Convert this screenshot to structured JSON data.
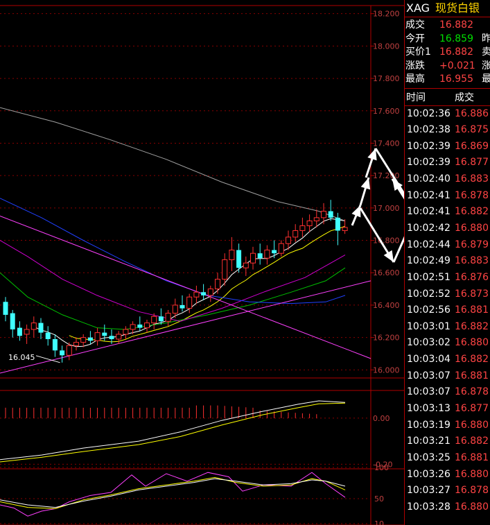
{
  "panel": {
    "symbol": "XAG",
    "name": "现货白银",
    "quotes": [
      {
        "label": "成交",
        "value": "16.882",
        "color": "#ff4444",
        "right": ""
      },
      {
        "label": "今开",
        "value": "16.859",
        "color": "#00e000",
        "right": "昨"
      },
      {
        "label": "买价1",
        "value": "16.882",
        "color": "#ff4444",
        "right": "卖"
      },
      {
        "label": "涨跌",
        "value": "+0.021",
        "color": "#ff4444",
        "right": "涨"
      },
      {
        "label": "最高",
        "value": "16.955",
        "color": "#ff4444",
        "right": "最"
      }
    ],
    "header_time": "时间",
    "header_price": "成交",
    "ticks": [
      {
        "time": "10:02:36",
        "price": "16.886"
      },
      {
        "time": "10:02:38",
        "price": "16.875"
      },
      {
        "time": "10:02:39",
        "price": "16.869"
      },
      {
        "time": "10:02:39",
        "price": "16.877"
      },
      {
        "time": "10:02:40",
        "price": "16.883"
      },
      {
        "time": "10:02:41",
        "price": "16.878"
      },
      {
        "time": "10:02:41",
        "price": "16.882"
      },
      {
        "time": "10:02:42",
        "price": "16.880"
      },
      {
        "time": "10:02:44",
        "price": "16.879"
      },
      {
        "time": "10:02:49",
        "price": "16.883"
      },
      {
        "time": "10:02:51",
        "price": "16.876"
      },
      {
        "time": "10:02:52",
        "price": "16.873"
      },
      {
        "time": "10:02:56",
        "price": "16.881"
      },
      {
        "time": "10:03:01",
        "price": "16.882"
      },
      {
        "time": "10:03:02",
        "price": "16.880"
      },
      {
        "time": "10:03:04",
        "price": "16.882"
      },
      {
        "time": "10:03:07",
        "price": "16.881"
      },
      {
        "time": "10:03:07",
        "price": "16.878"
      },
      {
        "time": "10:03:13",
        "price": "16.877"
      },
      {
        "time": "10:03:19",
        "price": "16.880"
      },
      {
        "time": "10:03:21",
        "price": "16.882"
      },
      {
        "time": "10:03:25",
        "price": "16.881"
      },
      {
        "time": "10:03:26",
        "price": "16.880"
      },
      {
        "time": "10:03:27",
        "price": "16.878"
      },
      {
        "time": "10:03:28",
        "price": "16.880"
      }
    ]
  },
  "chart_data": [
    {
      "type": "candlestick",
      "ylim": [
        15.95,
        18.25
      ],
      "yticks": [
        "16.000",
        "16.200",
        "16.400",
        "16.600",
        "16.800",
        "17.000",
        "17.200",
        "17.400",
        "17.600",
        "17.800",
        "18.000",
        "18.200"
      ],
      "annotation_low": "16.045",
      "ohlc": [
        [
          16.42,
          16.45,
          16.3,
          16.34
        ],
        [
          16.35,
          16.37,
          16.2,
          16.25
        ],
        [
          16.26,
          16.3,
          16.18,
          16.21
        ],
        [
          16.22,
          16.28,
          16.16,
          16.25
        ],
        [
          16.25,
          16.33,
          16.2,
          16.29
        ],
        [
          16.29,
          16.32,
          16.19,
          16.23
        ],
        [
          16.23,
          16.27,
          16.15,
          16.19
        ],
        [
          16.19,
          16.22,
          16.08,
          16.12
        ],
        [
          16.12,
          16.15,
          16.045,
          16.09
        ],
        [
          16.09,
          16.17,
          16.06,
          16.15
        ],
        [
          16.15,
          16.2,
          16.12,
          16.17
        ],
        [
          16.17,
          16.22,
          16.14,
          16.2
        ],
        [
          16.2,
          16.24,
          16.16,
          16.18
        ],
        [
          16.18,
          16.26,
          16.15,
          16.23
        ],
        [
          16.23,
          16.28,
          16.18,
          16.21
        ],
        [
          16.21,
          16.25,
          16.16,
          16.19
        ],
        [
          16.19,
          16.24,
          16.16,
          16.22
        ],
        [
          16.22,
          16.27,
          16.19,
          16.25
        ],
        [
          16.25,
          16.3,
          16.22,
          16.28
        ],
        [
          16.28,
          16.33,
          16.24,
          16.26
        ],
        [
          16.26,
          16.31,
          16.23,
          16.29
        ],
        [
          16.29,
          16.35,
          16.25,
          16.33
        ],
        [
          16.33,
          16.38,
          16.28,
          16.3
        ],
        [
          16.3,
          16.37,
          16.27,
          16.35
        ],
        [
          16.35,
          16.44,
          16.32,
          16.4
        ],
        [
          16.4,
          16.46,
          16.36,
          16.38
        ],
        [
          16.38,
          16.47,
          16.35,
          16.45
        ],
        [
          16.45,
          16.52,
          16.41,
          16.48
        ],
        [
          16.48,
          16.53,
          16.43,
          16.46
        ],
        [
          16.46,
          16.52,
          16.42,
          16.5
        ],
        [
          16.5,
          16.6,
          16.47,
          16.56
        ],
        [
          16.56,
          16.72,
          16.52,
          16.68
        ],
        [
          16.68,
          16.82,
          16.61,
          16.74
        ],
        [
          16.74,
          16.78,
          16.6,
          16.63
        ],
        [
          16.63,
          16.7,
          16.58,
          16.66
        ],
        [
          16.66,
          16.76,
          16.62,
          16.72
        ],
        [
          16.72,
          16.78,
          16.65,
          16.69
        ],
        [
          16.69,
          16.77,
          16.65,
          16.74
        ],
        [
          16.74,
          16.8,
          16.69,
          16.72
        ],
        [
          16.72,
          16.8,
          16.7,
          16.78
        ],
        [
          16.78,
          16.86,
          16.74,
          16.82
        ],
        [
          16.82,
          16.9,
          16.79,
          16.86
        ],
        [
          16.86,
          16.94,
          16.82,
          16.89
        ],
        [
          16.89,
          16.96,
          16.85,
          16.92
        ],
        [
          16.92,
          16.99,
          16.88,
          16.94
        ],
        [
          16.94,
          17.03,
          16.9,
          16.98
        ],
        [
          16.98,
          17.05,
          16.92,
          16.94
        ],
        [
          16.94,
          16.97,
          16.77,
          16.86
        ],
        [
          16.86,
          16.93,
          16.84,
          16.88
        ]
      ]
    },
    {
      "type": "bar",
      "ylim": [
        -0.22,
        0.12
      ],
      "yticks": [
        "0.00",
        "-0.20"
      ]
    },
    {
      "type": "line",
      "ylim": [
        10,
        100
      ],
      "yticks": [
        "100",
        "50",
        "10"
      ]
    }
  ]
}
